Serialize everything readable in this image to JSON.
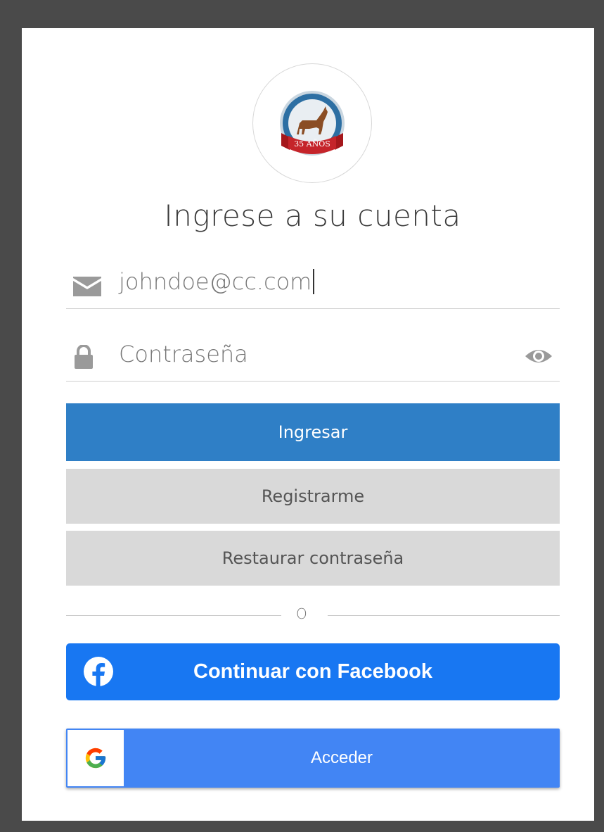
{
  "logo": {
    "badge_text": "35 AÑOS"
  },
  "heading": "Ingrese a su cuenta",
  "email": {
    "value": "johndoe@cc.com",
    "icon": "envelope-icon"
  },
  "password": {
    "placeholder": "Contraseña",
    "icon": "lock-icon",
    "toggle_icon": "eye-icon"
  },
  "buttons": {
    "login": "Ingresar",
    "register": "Registrarme",
    "restore": "Restaurar contraseña",
    "facebook": "Continuar con Facebook",
    "google": "Acceder"
  },
  "divider_text": "O",
  "colors": {
    "primary": "#2f7fc6",
    "secondary": "#d9d9d9",
    "facebook": "#1877f2",
    "google": "#4285f4"
  }
}
